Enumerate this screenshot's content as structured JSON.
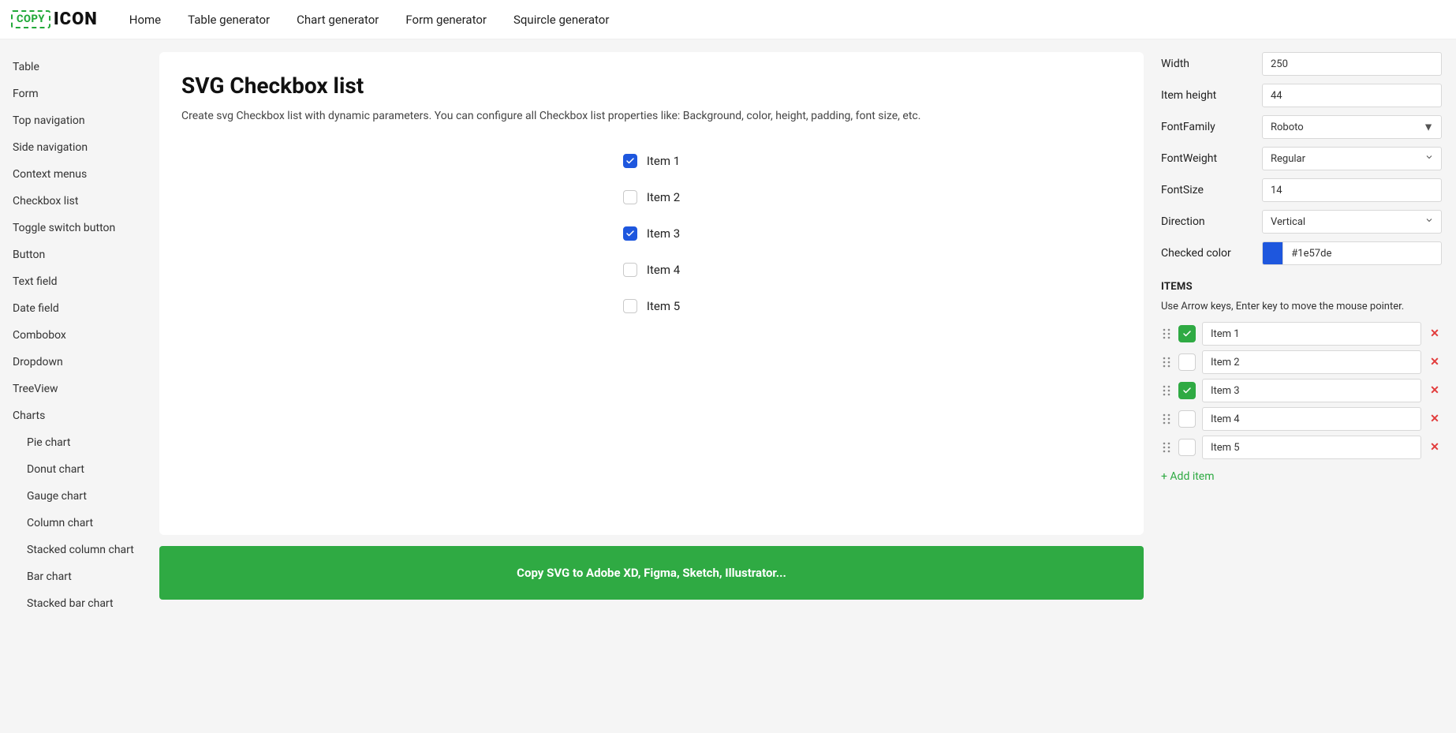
{
  "logo": {
    "copy": "COPY",
    "text": "ICON"
  },
  "topnav": [
    "Home",
    "Table generator",
    "Chart generator",
    "Form generator",
    "Squircle generator"
  ],
  "sidebar": [
    {
      "label": "Table"
    },
    {
      "label": "Form"
    },
    {
      "label": "Top navigation"
    },
    {
      "label": "Side navigation"
    },
    {
      "label": "Context menus"
    },
    {
      "label": "Checkbox list"
    },
    {
      "label": "Toggle switch button"
    },
    {
      "label": "Button"
    },
    {
      "label": "Text field"
    },
    {
      "label": "Date field"
    },
    {
      "label": "Combobox"
    },
    {
      "label": "Dropdown"
    },
    {
      "label": "TreeView"
    },
    {
      "label": "Charts"
    },
    {
      "label": "Pie chart",
      "sub": true
    },
    {
      "label": "Donut chart",
      "sub": true
    },
    {
      "label": "Gauge chart",
      "sub": true
    },
    {
      "label": "Column chart",
      "sub": true
    },
    {
      "label": "Stacked column chart",
      "sub": true
    },
    {
      "label": "Bar chart",
      "sub": true
    },
    {
      "label": "Stacked bar chart",
      "sub": true
    }
  ],
  "page": {
    "title": "SVG Checkbox list",
    "desc": "Create svg Checkbox list with dynamic parameters. You can configure all Checkbox list properties like: Background, color, height, padding, font size, etc."
  },
  "preview_items": [
    {
      "label": "Item 1",
      "checked": true
    },
    {
      "label": "Item 2",
      "checked": false
    },
    {
      "label": "Item 3",
      "checked": true
    },
    {
      "label": "Item 4",
      "checked": false
    },
    {
      "label": "Item 5",
      "checked": false
    }
  ],
  "copy_button": "Copy SVG to Adobe XD, Figma, Sketch, Illustrator...",
  "panel": {
    "width": {
      "label": "Width",
      "value": "250"
    },
    "item_height": {
      "label": "Item height",
      "value": "44"
    },
    "font_family": {
      "label": "FontFamily",
      "value": "Roboto"
    },
    "font_weight": {
      "label": "FontWeight",
      "value": "Regular"
    },
    "font_size": {
      "label": "FontSize",
      "value": "14"
    },
    "direction": {
      "label": "Direction",
      "value": "Vertical"
    },
    "checked_color": {
      "label": "Checked color",
      "value": "#1e57de"
    },
    "items_heading": "ITEMS",
    "items_hint": "Use Arrow keys, Enter key to move the mouse pointer.",
    "add_item": "+ Add item"
  },
  "panel_items": [
    {
      "label": "Item 1",
      "checked": true
    },
    {
      "label": "Item 2",
      "checked": false
    },
    {
      "label": "Item 3",
      "checked": true
    },
    {
      "label": "Item 4",
      "checked": false
    },
    {
      "label": "Item 5",
      "checked": false
    }
  ]
}
